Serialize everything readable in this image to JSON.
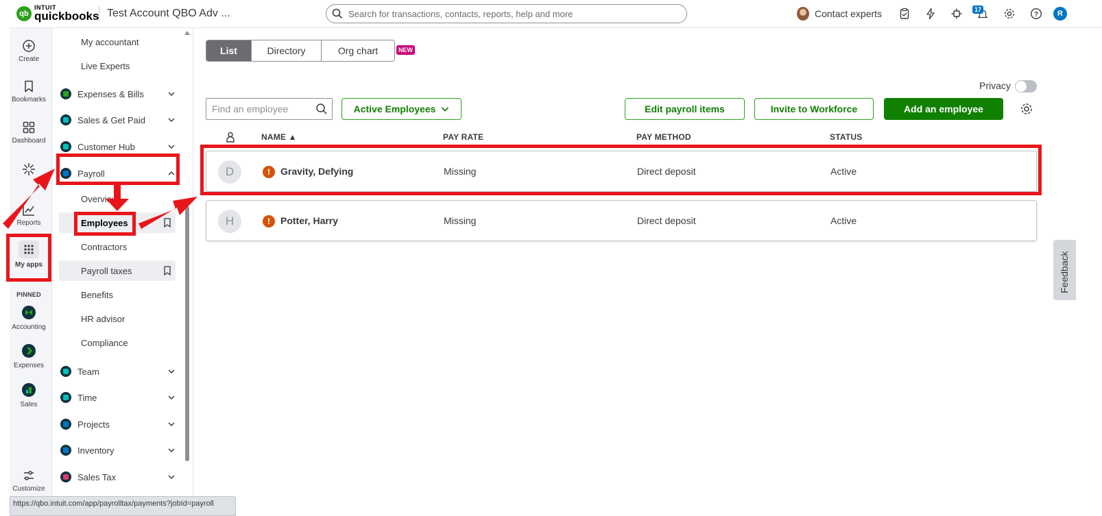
{
  "header": {
    "logo_intuit": "INTUIT",
    "logo_product": "quickbooks",
    "company_name": "Test Account QBO Adv ...",
    "search_placeholder": "Search for transactions, contacts, reports, help and more",
    "contact_experts": "Contact experts",
    "notifications_count": "17",
    "user_initial": "R"
  },
  "rail": {
    "items": [
      {
        "label": "Create",
        "icon": "plus-circle-icon"
      },
      {
        "label": "Bookmarks",
        "icon": "bookmark-icon"
      },
      {
        "label": "Dashboard",
        "icon": "dashboard-icon"
      },
      {
        "label": "",
        "icon": "sparkle-icon"
      },
      {
        "label": "Reports",
        "icon": "chart-line-icon"
      },
      {
        "label": "My apps",
        "icon": "apps-grid-icon"
      }
    ],
    "pinned_label": "PINNED",
    "pinned": [
      {
        "label": "Accounting",
        "icon": "accounting-icon"
      },
      {
        "label": "Expenses",
        "icon": "expenses-icon"
      },
      {
        "label": "Sales",
        "icon": "sales-icon"
      }
    ],
    "customize_label": "Customize"
  },
  "menu": {
    "top_links": [
      "My accountant",
      "Live Experts"
    ],
    "sections": [
      {
        "label": "Expenses & Bills",
        "color": "#2ca01c"
      },
      {
        "label": "Sales & Get Paid",
        "color": "#00c1bf"
      },
      {
        "label": "Customer Hub",
        "color": "#00c1bf"
      },
      {
        "label": "Payroll",
        "color": "#0077c5"
      }
    ],
    "payroll_items": [
      {
        "label": "Overview"
      },
      {
        "label": "Employees"
      },
      {
        "label": "Contractors"
      },
      {
        "label": "Payroll taxes"
      },
      {
        "label": "Benefits"
      },
      {
        "label": "HR advisor"
      },
      {
        "label": "Compliance"
      }
    ],
    "lower_sections": [
      {
        "label": "Team",
        "color": "#00c1bf"
      },
      {
        "label": "Time",
        "color": "#00c1bf"
      },
      {
        "label": "Projects",
        "color": "#0077c5"
      },
      {
        "label": "Inventory",
        "color": "#0077c5"
      },
      {
        "label": "Sales Tax",
        "color": "#e6376b"
      }
    ]
  },
  "main": {
    "tabs": [
      "List",
      "Directory",
      "Org chart"
    ],
    "new_badge": "NEW",
    "privacy_label": "Privacy",
    "find_placeholder": "Find an employee",
    "filter_label": "Active Employees",
    "edit_payroll_label": "Edit payroll items",
    "invite_label": "Invite to Workforce",
    "add_employee_label": "Add an employee",
    "columns": [
      "NAME ▲",
      "PAY RATE",
      "PAY METHOD",
      "STATUS"
    ],
    "rows": [
      {
        "initial": "D",
        "name": "Gravity, Defying",
        "pay_rate": "Missing",
        "pay_method": "Direct deposit",
        "status": "Active"
      },
      {
        "initial": "H",
        "name": "Potter, Harry",
        "pay_rate": "Missing",
        "pay_method": "Direct deposit",
        "status": "Active"
      }
    ]
  },
  "feedback_label": "Feedback",
  "status_url": "https://qbo.intuit.com/app/payrolltax/payments?jobId=payroll"
}
